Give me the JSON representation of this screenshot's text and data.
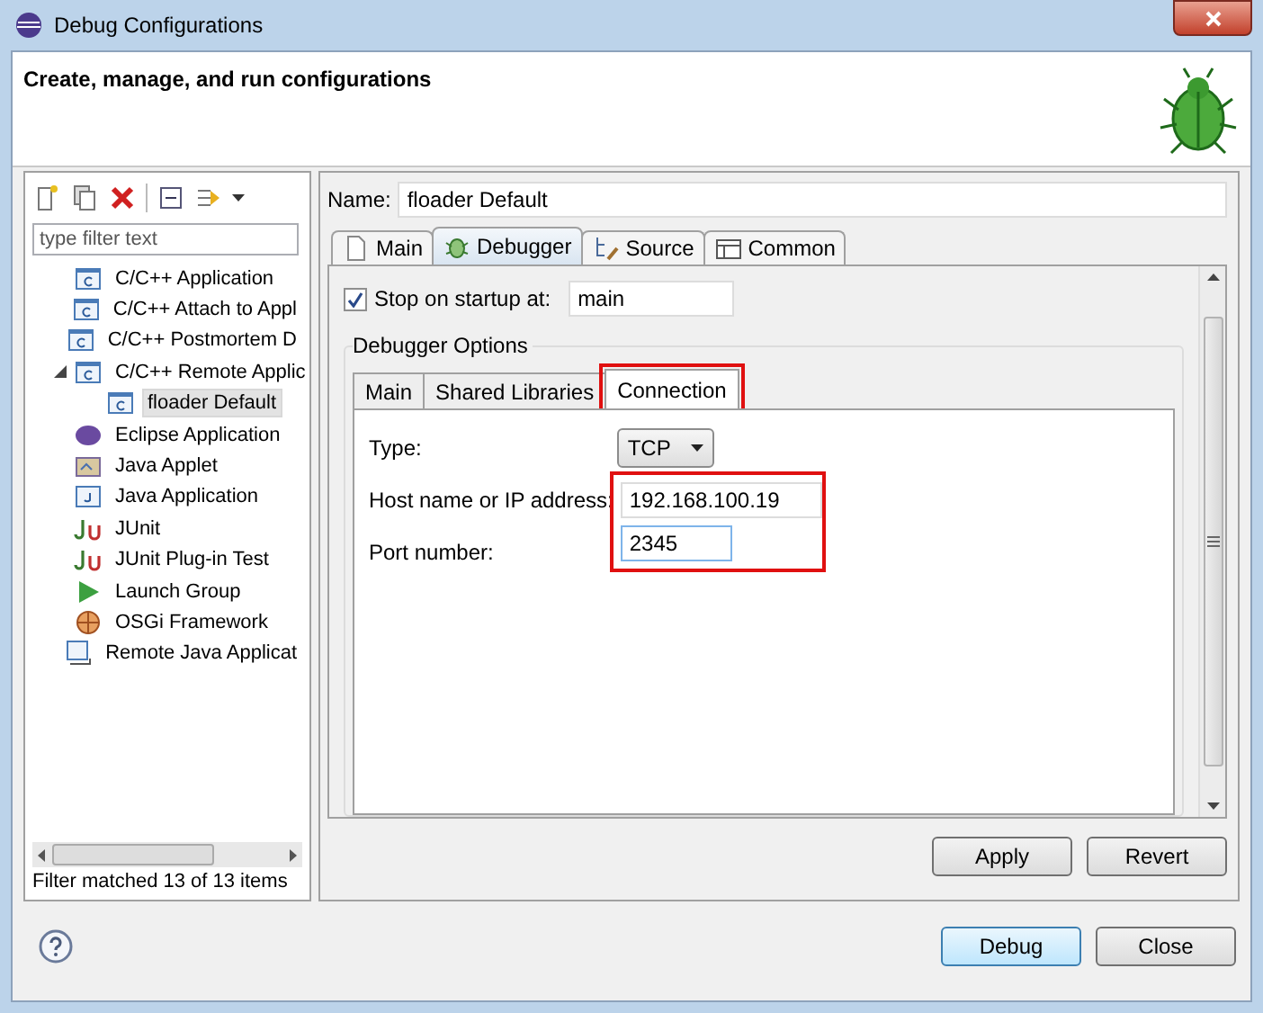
{
  "window": {
    "title": "Debug Configurations"
  },
  "header": {
    "title": "Create, manage, and run configurations"
  },
  "sidebar": {
    "filter": {
      "placeholder": "type filter text"
    },
    "tree": [
      {
        "label": "C/C++ Application",
        "kind": "c",
        "selected": false
      },
      {
        "label": "C/C++ Attach to Appl",
        "kind": "c",
        "selected": false
      },
      {
        "label": "C/C++ Postmortem D",
        "kind": "c",
        "selected": false
      },
      {
        "label": "C/C++ Remote Applic",
        "kind": "c",
        "selected": false,
        "expanded": true,
        "children": [
          {
            "label": "floader Default",
            "kind": "c",
            "selected": true
          }
        ]
      },
      {
        "label": "Eclipse Application",
        "kind": "eclipse",
        "selected": false
      },
      {
        "label": "Java Applet",
        "kind": "applet",
        "selected": false
      },
      {
        "label": "Java Application",
        "kind": "java",
        "selected": false
      },
      {
        "label": "JUnit",
        "kind": "junit",
        "selected": false
      },
      {
        "label": "JUnit Plug-in Test",
        "kind": "junit",
        "selected": false
      },
      {
        "label": "Launch Group",
        "kind": "launch",
        "selected": false
      },
      {
        "label": "OSGi Framework",
        "kind": "osgi",
        "selected": false
      },
      {
        "label": "Remote Java Applicat",
        "kind": "remote",
        "selected": false
      }
    ],
    "status": "Filter matched 13 of 13 items"
  },
  "editor": {
    "name_label": "Name:",
    "name_value": "floader Default",
    "tabs": [
      {
        "label": "Main",
        "kind": "main",
        "selected": false
      },
      {
        "label": "Debugger",
        "kind": "debugger",
        "selected": true
      },
      {
        "label": "Source",
        "kind": "source",
        "selected": false
      },
      {
        "label": "Common",
        "kind": "common",
        "selected": false
      }
    ],
    "stop_on_startup": {
      "label": "Stop on startup at:",
      "checked": true,
      "value": "main"
    },
    "options_group": "Debugger Options",
    "subtabs": [
      {
        "label": "Main",
        "selected": false,
        "highlighted": false
      },
      {
        "label": "Shared Libraries",
        "selected": false,
        "highlighted": false
      },
      {
        "label": "Connection",
        "selected": true,
        "highlighted": true
      }
    ],
    "connection": {
      "type_label": "Type:",
      "type_value": "TCP",
      "host_label": "Host name or IP address:",
      "host_value": "192.168.100.19",
      "port_label": "Port number:",
      "port_value": "2345",
      "fields_highlighted": true
    },
    "buttons": [
      "Apply",
      "Revert"
    ]
  },
  "footer": {
    "buttons": [
      {
        "label": "Debug",
        "default": true
      },
      {
        "label": "Close",
        "default": false
      }
    ]
  }
}
